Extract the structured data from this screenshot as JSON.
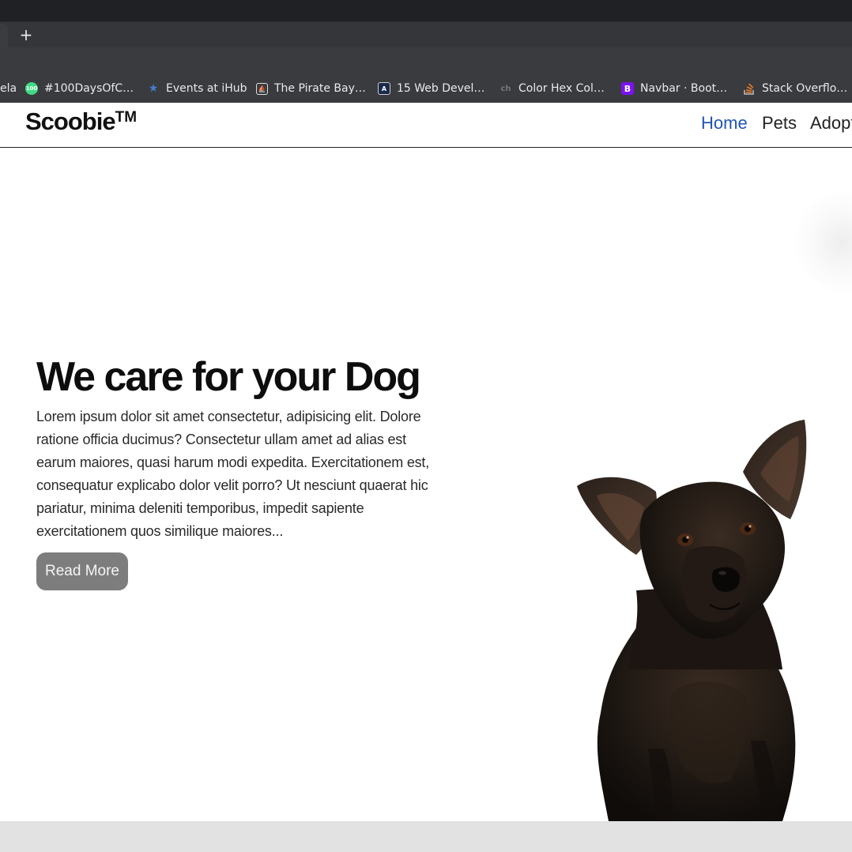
{
  "browser": {
    "new_tab_label": "+",
    "bookmarks": [
      {
        "label": "ela",
        "icon": "none"
      },
      {
        "label": "#100DaysOfC…",
        "icon": "100days-icon",
        "color": "#3ddc84"
      },
      {
        "label": "Events at iHub",
        "icon": "star-icon",
        "color": "#4a7bd0"
      },
      {
        "label": "The Pirate Bay…",
        "icon": "pirate-ship-icon",
        "color": "#dddddd"
      },
      {
        "label": "15 Web Devel…",
        "icon": "dev-icon",
        "color": "#1b2a4a"
      },
      {
        "label": "Color Hex Col…",
        "icon": "colorhex-icon",
        "color": "#666666"
      },
      {
        "label": "Navbar · Boot…",
        "icon": "bootstrap-icon",
        "color": "#7b12f2"
      },
      {
        "label": "Stack Overflo…",
        "icon": "stackoverflow-icon",
        "color": "#f48024"
      }
    ]
  },
  "site": {
    "brand": "Scoobie",
    "brand_mark": "TM",
    "nav": [
      {
        "label": "Home",
        "active": true
      },
      {
        "label": "Pets",
        "active": false
      },
      {
        "label": "Adopt",
        "active": false
      }
    ],
    "hero": {
      "title": "We care for your Dog",
      "text": "Lorem ipsum dolor sit amet consectetur, adipisicing elit. Dolore ratione officia ducimus? Consectetur ullam amet ad alias est earum maiores, quasi harum modi expedita. Exercitationem est, consequatur explicabo dolor velit porro? Ut nesciunt quaerat hic pariatur, minima deleniti temporibus, impedit sapiente exercitationem quos similique maiores...",
      "button": "Read More",
      "image": "black-dog-photo"
    }
  },
  "colors": {
    "accent": "#1f55b5",
    "button_bg": "#7d7d7d",
    "chrome_dark": "#202124"
  }
}
